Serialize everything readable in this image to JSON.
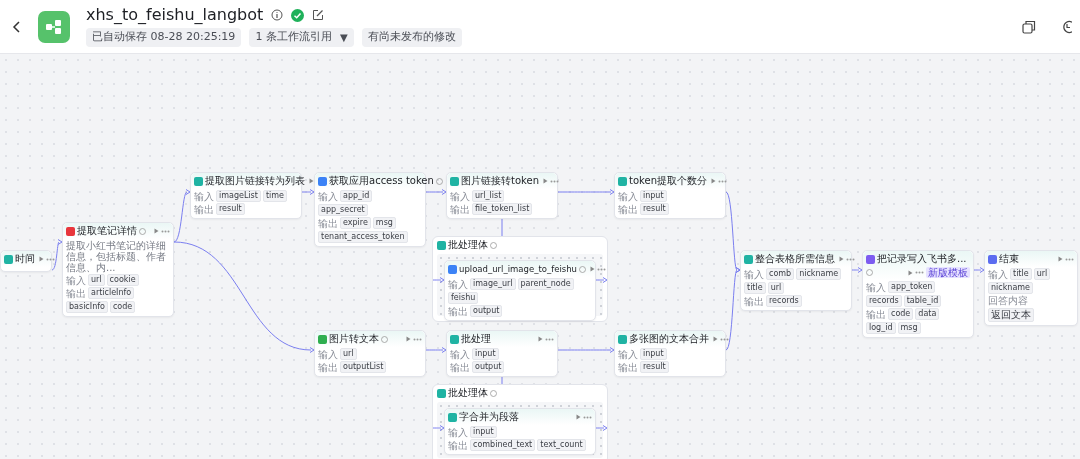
{
  "header": {
    "title": "xhs_to_feishu_langbot",
    "saved": "已自动保存 08-28 20:25:19",
    "references": "1 条工作流引用",
    "references_caret": "▼",
    "unpublished": "有尚未发布的修改"
  },
  "nodes": [
    {
      "kind": "node",
      "title": "时间",
      "color": "#1fb3a3",
      "info_icon": false
    },
    {
      "kind": "node",
      "title": "提取笔记详情",
      "color": "#e8363c",
      "info_icon": true,
      "description": "提取小红书笔记的详细信息，包括标题、作者信息、内...",
      "rows": [
        {
          "label": "输入",
          "chips": [
            "url",
            "cookie"
          ]
        },
        {
          "label": "输出",
          "chips": [
            "articleInfo",
            "basicInfo",
            "code"
          ]
        }
      ]
    },
    {
      "kind": "node",
      "title": "提取图片链接转为列表",
      "color": "#1fb3a3",
      "info_icon": false,
      "rows": [
        {
          "label": "输入",
          "chips": [
            "imageList",
            "time"
          ]
        },
        {
          "label": "输出",
          "chips": [
            "result"
          ]
        }
      ]
    },
    {
      "kind": "node",
      "title": "获取应用access token",
      "color": "#3b82f6",
      "info_icon": true,
      "rows": [
        {
          "label": "输入",
          "chips": [
            "app_id",
            "app_secret"
          ]
        },
        {
          "label": "输出",
          "chips": [
            "expire",
            "msg",
            "tenant_access_token"
          ]
        }
      ]
    },
    {
      "kind": "node",
      "title": "图片链接转token",
      "color": "#1fb3a3",
      "info_icon": false,
      "rows": [
        {
          "label": "输入",
          "chips": [
            "url_list"
          ]
        },
        {
          "label": "输出",
          "chips": [
            "file_token_list"
          ]
        }
      ]
    },
    {
      "kind": "node",
      "title": "token提取个数分",
      "color": "#1fb3a3",
      "info_icon": false,
      "rows": [
        {
          "label": "输入",
          "chips": [
            "input"
          ]
        },
        {
          "label": "输出",
          "chips": [
            "result"
          ]
        }
      ]
    },
    {
      "kind": "loop",
      "title": "批处理体",
      "color": "#1fb3a3",
      "info_icon": true,
      "children": [
        {
          "kind": "node",
          "title": "upload_url_image_to_feishu",
          "color": "#3b82f6",
          "info_icon": true,
          "rows": [
            {
              "label": "输入",
              "chips": [
                "image_url",
                "parent_node",
                "feishu"
              ]
            },
            {
              "label": "输出",
              "chips": [
                "output"
              ]
            }
          ]
        }
      ]
    },
    {
      "kind": "node",
      "title": "整合表格所需信息",
      "color": "#1fb3a3",
      "info_icon": false,
      "rows": [
        {
          "label": "输入",
          "chips": [
            "comb",
            "nickname",
            "title",
            "url"
          ]
        },
        {
          "label": "输出",
          "chips": [
            "records"
          ]
        }
      ]
    },
    {
      "kind": "node",
      "title": "把记录写入飞书多...",
      "color": "#7c5cf0",
      "info_icon": true,
      "badge": "新版模板",
      "rows": [
        {
          "label": "输入",
          "chips": [
            "app_token",
            "records",
            "table_id"
          ]
        },
        {
          "label": "输出",
          "chips": [
            "code",
            "data",
            "log_id",
            "msg"
          ]
        }
      ]
    },
    {
      "kind": "node",
      "title": "结束",
      "color": "#5b6cf0",
      "info_icon": false,
      "rows": [
        {
          "label": "输入",
          "chips": [
            "title",
            "url",
            "nickname"
          ]
        },
        {
          "label": "回答内容",
          "chips": [
            "返回文本"
          ]
        }
      ]
    },
    {
      "kind": "node",
      "title": "图片转文本",
      "color": "#2fae4f",
      "info_icon": true,
      "rows": [
        {
          "label": "输入",
          "chips": [
            "url"
          ]
        },
        {
          "label": "输出",
          "chips": [
            "outputList"
          ]
        }
      ]
    },
    {
      "kind": "node",
      "title": "批处理",
      "color": "#1fb3a3",
      "info_icon": false,
      "rows": [
        {
          "label": "输入",
          "chips": [
            "input"
          ]
        },
        {
          "label": "输出",
          "chips": [
            "output"
          ]
        }
      ]
    },
    {
      "kind": "node",
      "title": "多张图的文本合并",
      "color": "#1fb3a3",
      "info_icon": false,
      "rows": [
        {
          "label": "输入",
          "chips": [
            "input"
          ]
        },
        {
          "label": "输出",
          "chips": [
            "result"
          ]
        }
      ]
    },
    {
      "kind": "loop",
      "title": "批处理体",
      "color": "#1fb3a3",
      "info_icon": true,
      "children": [
        {
          "kind": "node",
          "title": "字合并为段落",
          "color": "#1fb3a3",
          "info_icon": false,
          "rows": [
            {
              "label": "输入",
              "chips": [
                "input"
              ]
            },
            {
              "label": "输出",
              "chips": [
                "combined_text",
                "text_count"
              ]
            }
          ]
        }
      ]
    }
  ]
}
